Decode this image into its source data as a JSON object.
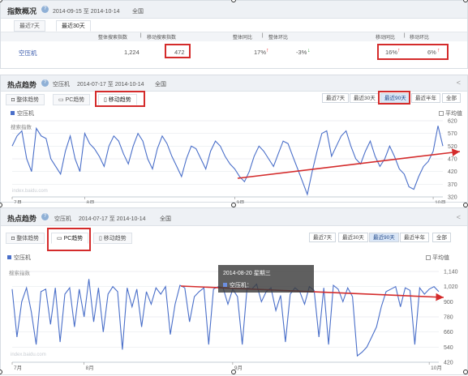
{
  "overview": {
    "title": "指数概况",
    "date_range": "2014-09-15 至 2014-10-14",
    "region": "全国",
    "tabs": [
      "最近7天",
      "最近30天"
    ],
    "col_headers": [
      "整体搜索指数",
      "移动搜索指数",
      "整体同比",
      "整体环比",
      "移动同比",
      "移动环比"
    ],
    "row": {
      "keyword": "空压机",
      "overall_index": "1,224",
      "mobile_index": "472",
      "overall_yoy": "17%",
      "overall_mom": "-3%",
      "mobile_yoy": "16%",
      "mobile_mom": "6%"
    }
  },
  "trend_mobile": {
    "title": "热点趋势",
    "keyword": "空压机",
    "date_range": "2014-07-17 至 2014-10-14",
    "region": "全国",
    "tabs": [
      "整体趋势",
      "PC趋势",
      "移动趋势"
    ],
    "ranges": [
      "最近7天",
      "最近30天",
      "最近90天",
      "最近半年",
      "全部"
    ],
    "legend": "空压机",
    "avg_label": "平均值",
    "ylabel": "搜索指数",
    "yticks": [
      "620",
      "570",
      "520",
      "470",
      "420",
      "370",
      "320"
    ],
    "xticks": [
      "7月",
      "8月",
      "9月",
      "10月"
    ],
    "watermark": "index.baidu.com"
  },
  "trend_pc": {
    "title": "热点趋势",
    "keyword": "空压机",
    "date_range": "2014-07-17 至 2014-10-14",
    "region": "全国",
    "tabs": [
      "整体趋势",
      "PC趋势",
      "移动趋势"
    ],
    "ranges": [
      "最近7天",
      "最近30天",
      "最近90天",
      "最近半年",
      "全部"
    ],
    "legend": "空压机",
    "avg_label": "平均值",
    "ylabel": "搜索指数",
    "yticks": [
      "1,140",
      "1,020",
      "900",
      "780",
      "660",
      "540",
      "420"
    ],
    "xticks": [
      "7月",
      "8月",
      "9月",
      "10月"
    ],
    "tooltip_date": "2014-08-20 星期三",
    "tooltip_series": "空压机：",
    "watermark": "index.baidu.com"
  },
  "colors": {
    "line": "#4a6fc9",
    "highlight": "#d42b2b",
    "up": "#e33",
    "down": "#2a9a3a"
  },
  "chart_data": [
    {
      "type": "line",
      "title": "",
      "ylabel": "搜索指数",
      "ylim": [
        320,
        620
      ],
      "series": [
        {
          "name": "空压机",
          "values": [
            520,
            560,
            580,
            470,
            420,
            590,
            560,
            550,
            470,
            440,
            410,
            500,
            560,
            470,
            420,
            570,
            530,
            510,
            480,
            440,
            520,
            560,
            540,
            490,
            450,
            520,
            570,
            540,
            470,
            430,
            510,
            560,
            530,
            480,
            440,
            400,
            470,
            520,
            510,
            470,
            430,
            500,
            540,
            520,
            480,
            450,
            430,
            400,
            380,
            420,
            480,
            520,
            500,
            470,
            440,
            490,
            540,
            530,
            480,
            430,
            380,
            330,
            420,
            500,
            570,
            580,
            480,
            520,
            560,
            580,
            520,
            470,
            450,
            500,
            540,
            480,
            440,
            470,
            520,
            480,
            430,
            410,
            360,
            350,
            400,
            440,
            460,
            500,
            600,
            520
          ]
        }
      ],
      "x": "2014-07-17 .. 2014-10-14 (daily)"
    },
    {
      "type": "line",
      "title": "",
      "ylabel": "搜索指数",
      "ylim": [
        420,
        1140
      ],
      "series": [
        {
          "name": "空压机",
          "values": [
            1000,
            620,
            900,
            1010,
            820,
            560,
            980,
            1000,
            720,
            1010,
            580,
            960,
            1010,
            700,
            1000,
            780,
            1080,
            740,
            1010,
            660,
            960,
            1020,
            980,
            520,
            1010,
            860,
            1000,
            700,
            980,
            880,
            1010,
            960,
            1020,
            640,
            880,
            1030,
            1010,
            740,
            940,
            980,
            1010,
            560,
            1000,
            1020,
            1010,
            880,
            1000,
            940,
            560,
            1010,
            1000,
            1040,
            900,
            980,
            1010,
            830,
            950,
            580,
            960,
            1010,
            980,
            880,
            1020,
            990,
            620,
            1010,
            560,
            1030,
            1000,
            900,
            1010,
            940,
            470,
            500,
            540,
            620,
            700,
            860,
            980,
            1000,
            1020,
            860,
            1010,
            990,
            560,
            1010,
            960,
            1000,
            1020,
            980
          ]
        }
      ],
      "x": "2014-07-17 .. 2014-10-14 (daily)"
    }
  ]
}
